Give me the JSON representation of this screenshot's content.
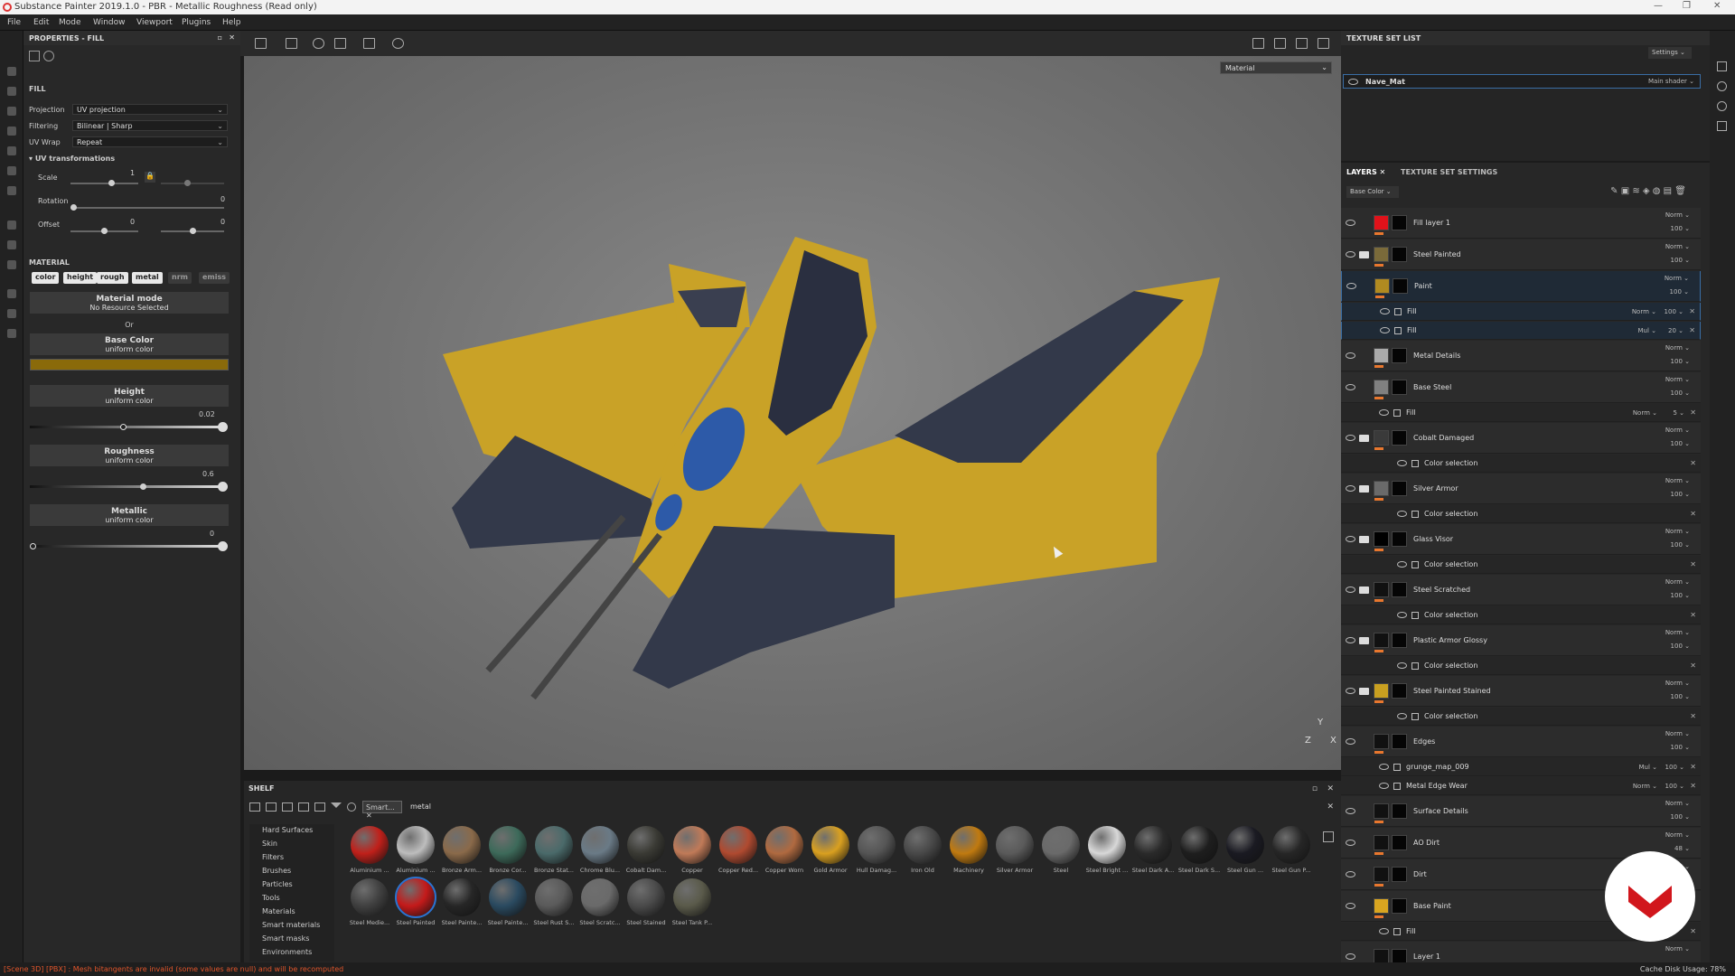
{
  "app": {
    "title": "Substance Painter 2019.1.0 - PBR - Metallic Roughness (Read only)"
  },
  "menu": [
    "File",
    "Edit",
    "Mode",
    "Window",
    "Viewport",
    "Plugins",
    "Help"
  ],
  "properties": {
    "header": "PROPERTIES - FILL",
    "section": "FILL",
    "projection_label": "Projection",
    "projection_value": "UV projection",
    "filtering_label": "Filtering",
    "filtering_value": "Bilinear | Sharp",
    "uvwrap_label": "UV Wrap",
    "uvwrap_value": "Repeat",
    "uvtransform_label": "UV transformations",
    "scale_label": "Scale",
    "scale_value": "1",
    "rotation_label": "Rotation",
    "rotation_value": "0",
    "offset_label": "Offset",
    "offset_x": "0",
    "offset_y": "0",
    "material_label": "MATERIAL",
    "channels": [
      {
        "label": "color",
        "on": true
      },
      {
        "label": "height",
        "on": true
      },
      {
        "label": "rough",
        "on": true
      },
      {
        "label": "metal",
        "on": true
      },
      {
        "label": "nrm",
        "on": false
      },
      {
        "label": "emiss",
        "on": false
      }
    ],
    "material_mode_title": "Material mode",
    "material_mode_sub": "No Resource Selected",
    "or_label": "Or",
    "base_color_title": "Base Color",
    "base_color_sub": "uniform color",
    "base_color_swatch": "#8a6a0a",
    "height_title": "Height",
    "height_sub": "uniform color",
    "height_value": "0.02",
    "roughness_title": "Roughness",
    "roughness_sub": "uniform color",
    "roughness_value": "0.6",
    "metallic_title": "Metallic",
    "metallic_sub": "uniform color",
    "metallic_value": "0"
  },
  "viewport": {
    "mode": "Material",
    "axis_y": "Y",
    "axis_z": "Z",
    "axis_x": "X"
  },
  "shelf": {
    "header": "SHELF",
    "filter_tag": "Smart...",
    "search_value": "metal",
    "categories": [
      "Hard Surfaces",
      "Skin",
      "Filters",
      "Brushes",
      "Particles",
      "Tools",
      "Materials",
      "Smart materials",
      "Smart masks",
      "Environments"
    ],
    "items_row1": [
      {
        "label": "Aluminium ...",
        "color": "#c0201a"
      },
      {
        "label": "Aluminium ...",
        "color": "#bdbdbd"
      },
      {
        "label": "Bronze Arm...",
        "color": "#8a6a4a"
      },
      {
        "label": "Bronze Cor...",
        "color": "#3d6a5a"
      },
      {
        "label": "Bronze Stat...",
        "color": "#4a6a6a"
      },
      {
        "label": "Chrome Blu...",
        "color": "#6a7a86"
      },
      {
        "label": "Cobalt Dam...",
        "color": "#3a3a34"
      },
      {
        "label": "Copper",
        "color": "#c07a58"
      },
      {
        "label": "Copper Red...",
        "color": "#b04a30"
      },
      {
        "label": "Copper Worn",
        "color": "#b06a40"
      },
      {
        "label": "Gold Armor",
        "color": "#d9a020"
      },
      {
        "label": "Hull Damag...",
        "color": "#555555"
      },
      {
        "label": "Iron Old",
        "color": "#484848"
      },
      {
        "label": "Machinery",
        "color": "#c07a10"
      },
      {
        "label": "Silver Armor",
        "color": "#5a5a5a"
      },
      {
        "label": "Steel",
        "color": "#6a6a6a"
      },
      {
        "label": "Steel Bright ...",
        "color": "#d8d8d8"
      },
      {
        "label": "Steel Dark A...",
        "color": "#2a2a2a"
      },
      {
        "label": "Steel Dark S...",
        "color": "#1e1e1e"
      },
      {
        "label": "Steel Gun ...",
        "color": "#1a1a22"
      },
      {
        "label": "Steel Gun P...",
        "color": "#262626"
      }
    ],
    "items_row2": [
      {
        "label": "Steel Medie...",
        "color": "#404040"
      },
      {
        "label": "Steel Painted",
        "color": "#c41a1a"
      },
      {
        "label": "Steel Painte...",
        "color": "#262626"
      },
      {
        "label": "Steel Painte...",
        "color": "#2a4a60"
      },
      {
        "label": "Steel Rust S...",
        "color": "#5a5a5a"
      },
      {
        "label": "Steel Scratc...",
        "color": "#6a6a6a"
      },
      {
        "label": "Steel Stained",
        "color": "#4a4a4a"
      },
      {
        "label": "Steel Tank P...",
        "color": "#5a5a4a"
      }
    ]
  },
  "texture_set_list": {
    "header": "TEXTURE SET LIST",
    "settings_label": "Settings",
    "item_name": "Nave_Mat",
    "shader": "Main shader"
  },
  "layers_panel": {
    "tab_layers": "LAYERS",
    "tab_tss": "TEXTURE SET SETTINGS",
    "channel": "Base Color",
    "rows": [
      {
        "name": "Fill layer 1",
        "blend": "Norm",
        "opacity": "100",
        "kind": "layer",
        "thumb": "#e0121a",
        "selected": false
      },
      {
        "name": "Steel Painted",
        "blend": "Norm",
        "opacity": "100",
        "kind": "folder",
        "thumb": "#7a6a3a",
        "selected": false
      },
      {
        "name": "Paint",
        "blend": "Norm",
        "opacity": "100",
        "kind": "layer",
        "thumb": "#b08a20",
        "selected": true
      },
      {
        "name": "Fill",
        "blend": "Norm",
        "opacity": "100",
        "kind": "effect",
        "thumb": "",
        "selected": true
      },
      {
        "name": "Fill",
        "blend": "Mul",
        "opacity": "20",
        "kind": "effect",
        "thumb": "",
        "selected": true
      },
      {
        "name": "Metal Details",
        "blend": "Norm",
        "opacity": "100",
        "kind": "layer",
        "thumb": "#aaaaaa",
        "selected": false
      },
      {
        "name": "Base Steel",
        "blend": "Norm",
        "opacity": "100",
        "kind": "layer",
        "thumb": "#808080",
        "selected": false
      },
      {
        "name": "Fill",
        "blend": "Norm",
        "opacity": "5",
        "kind": "effect",
        "thumb": "",
        "selected": false
      },
      {
        "name": "Cobalt Damaged",
        "blend": "Norm",
        "opacity": "100",
        "kind": "folder",
        "thumb": "#3a3a3a",
        "selected": false
      },
      {
        "name": "Color selection",
        "blend": "",
        "opacity": "",
        "kind": "mask",
        "thumb": "",
        "selected": false
      },
      {
        "name": "Silver Armor",
        "blend": "Norm",
        "opacity": "100",
        "kind": "folder",
        "thumb": "#6a6a6a",
        "selected": false
      },
      {
        "name": "Color selection",
        "blend": "",
        "opacity": "",
        "kind": "mask",
        "thumb": "",
        "selected": false
      },
      {
        "name": "Glass Visor",
        "blend": "Norm",
        "opacity": "100",
        "kind": "folder",
        "thumb": "#000000",
        "selected": false
      },
      {
        "name": "Color selection",
        "blend": "",
        "opacity": "",
        "kind": "mask",
        "thumb": "",
        "selected": false
      },
      {
        "name": "Steel Scratched",
        "blend": "Norm",
        "opacity": "100",
        "kind": "folder",
        "thumb": "#111111",
        "selected": false
      },
      {
        "name": "Color selection",
        "blend": "",
        "opacity": "",
        "kind": "mask",
        "thumb": "",
        "selected": false
      },
      {
        "name": "Plastic Armor Glossy",
        "blend": "Norm",
        "opacity": "100",
        "kind": "folder",
        "thumb": "#111111",
        "selected": false
      },
      {
        "name": "Color selection",
        "blend": "",
        "opacity": "",
        "kind": "mask",
        "thumb": "",
        "selected": false
      },
      {
        "name": "Steel Painted Stained",
        "blend": "Norm",
        "opacity": "100",
        "kind": "folder",
        "thumb": "#c9a020",
        "selected": false
      },
      {
        "name": "Color selection",
        "blend": "",
        "opacity": "",
        "kind": "mask",
        "thumb": "",
        "selected": false
      },
      {
        "name": "Edges",
        "blend": "Norm",
        "opacity": "100",
        "kind": "layer",
        "thumb": "#111111",
        "selected": false
      },
      {
        "name": "grunge_map_009",
        "blend": "Mul",
        "opacity": "100",
        "kind": "effect",
        "thumb": "",
        "selected": false
      },
      {
        "name": "Metal Edge Wear",
        "blend": "Norm",
        "opacity": "100",
        "kind": "effect",
        "thumb": "",
        "selected": false
      },
      {
        "name": "Surface Details",
        "blend": "Norm",
        "opacity": "100",
        "kind": "layer",
        "thumb": "#111111",
        "selected": false
      },
      {
        "name": "AO Dirt",
        "blend": "Norm",
        "opacity": "48",
        "kind": "layer",
        "thumb": "#111111",
        "selected": false
      },
      {
        "name": "Dirt",
        "blend": "Norm",
        "opacity": "",
        "kind": "layer",
        "thumb": "#111111",
        "selected": false
      },
      {
        "name": "Base Paint",
        "blend": "Norm",
        "opacity": "",
        "kind": "layer",
        "thumb": "#d9a520",
        "selected": false
      },
      {
        "name": "Fill",
        "blend": "",
        "opacity": "",
        "kind": "effect",
        "thumb": "",
        "selected": false
      },
      {
        "name": "Layer 1",
        "blend": "Norm",
        "opacity": "",
        "kind": "layer",
        "thumb": "#111111",
        "selected": false
      }
    ]
  },
  "status": {
    "error": "[Scene 3D] [PBX] : Mesh bitangents are invalid (some values are null) and will be recomputed",
    "cache": "Cache Disk Usage:  78%"
  }
}
